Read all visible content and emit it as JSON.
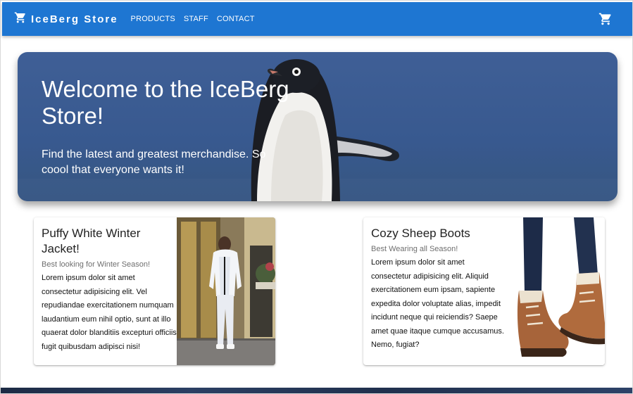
{
  "app": {
    "brand": "IceBerg Store",
    "nav": [
      "PRODUCTS",
      "STAFF",
      "CONTACT"
    ],
    "brand_icon": "cart-icon",
    "cart_icon": "cart-icon",
    "accent_color": "#1e76d2"
  },
  "hero": {
    "title": "Welcome to the IceBerg Store!",
    "subtitle": "Find the latest and greatest merchandise. So coool that everyone wants it!"
  },
  "cards": [
    {
      "title": "Puffy White Winter Jacket!",
      "subtitle": "Best looking for Winter Season!",
      "text": "Lorem ipsum dolor sit amet consectetur adipisicing elit. Vel repudiandae exercitationem numquam laudantium eum nihil optio, sunt at illo quaerat dolor blanditiis excepturi officiis fugit quibusdam adipisci nisi!"
    },
    {
      "title": "Cozy Sheep Boots",
      "subtitle": "Best Wearing all Season!",
      "text": "Lorem ipsum dolor sit amet consectetur adipisicing elit. Aliquid exercitationem eum ipsam, sapiente expedita dolor voluptate alias, impedit incidunt neque qui reiciendis? Saepe amet quae itaque cumque accusamus. Nemo, fugiat?"
    }
  ]
}
